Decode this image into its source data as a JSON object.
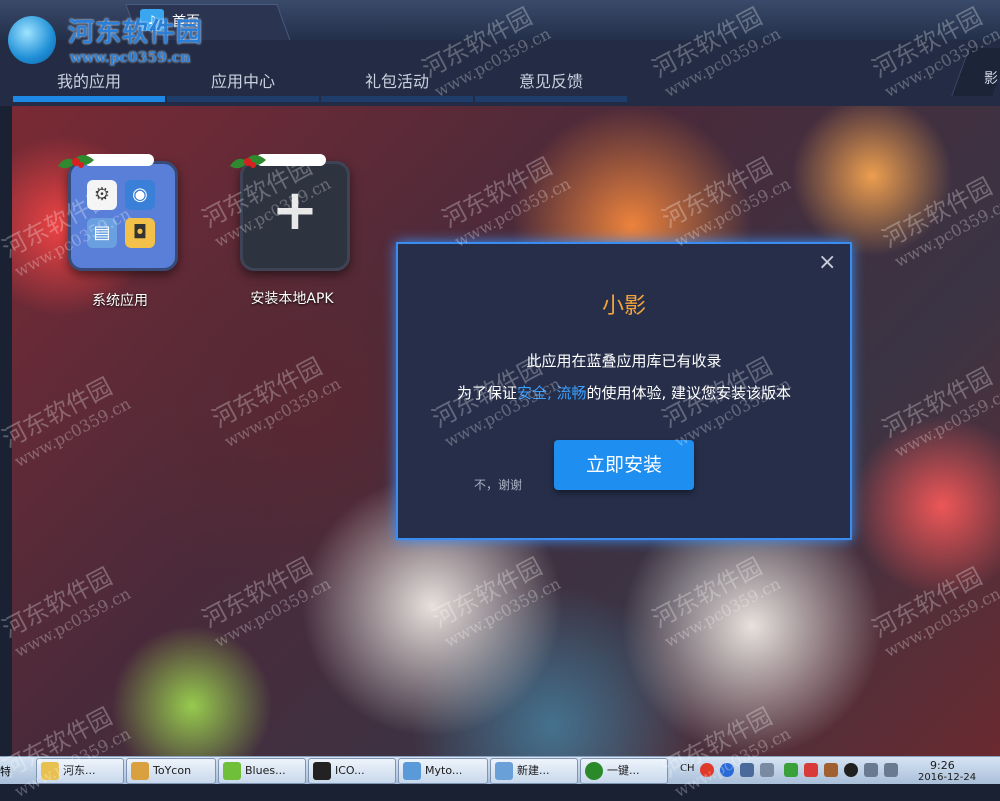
{
  "window": {
    "home_tab_label": "首页"
  },
  "watermark": {
    "logo_text": "河东软件园",
    "logo_url": "www.pc0359.cn",
    "repeat_text": "河东软件园",
    "repeat_url": "www.pc0359.cn"
  },
  "nav": {
    "items": [
      {
        "label": "我的应用",
        "active": true
      },
      {
        "label": "应用中心",
        "active": false
      },
      {
        "label": "礼包活动",
        "active": false
      },
      {
        "label": "意见反馈",
        "active": false
      }
    ],
    "right_label": "影"
  },
  "apps": [
    {
      "label": "系统应用",
      "icon": "system-apps-folder-icon"
    },
    {
      "label": "安装本地APK",
      "icon": "plus-icon"
    }
  ],
  "dialog": {
    "title": "小影",
    "close_icon": "×",
    "line1": "此应用在蓝叠应用库已有收录",
    "line2_prefix": "为了保证",
    "line2_link": "安全, 流畅",
    "line2_suffix": "的使用体验, 建议您安装该版本",
    "decline_label": "不，谢谢",
    "install_label": "立即安装"
  },
  "taskbar": {
    "left_fragment": "特",
    "tasks": [
      {
        "label": "河东...",
        "icon": "folder-icon",
        "color": "#e8c050"
      },
      {
        "label": "ToYcon",
        "icon": "box-icon",
        "color": "#d9a040"
      },
      {
        "label": "Blues...",
        "icon": "bluestacks-icon",
        "color": "#6fbf3a"
      },
      {
        "label": "ICO...",
        "icon": "ico-icon",
        "color": "#222222"
      },
      {
        "label": "Myto...",
        "icon": "image-icon",
        "color": "#5a9ad8"
      },
      {
        "label": "新建...",
        "icon": "document-icon",
        "color": "#6aa0d8"
      },
      {
        "label": "一键...",
        "icon": "tool-icon",
        "color": "#2a8a2a"
      }
    ],
    "ime_label": "CH",
    "clock_time": "9:26",
    "clock_date": "2016-12-24"
  },
  "colors": {
    "accent": "#1e88e5",
    "dialog_title": "#f2a43a",
    "link": "#3aa0ff"
  }
}
